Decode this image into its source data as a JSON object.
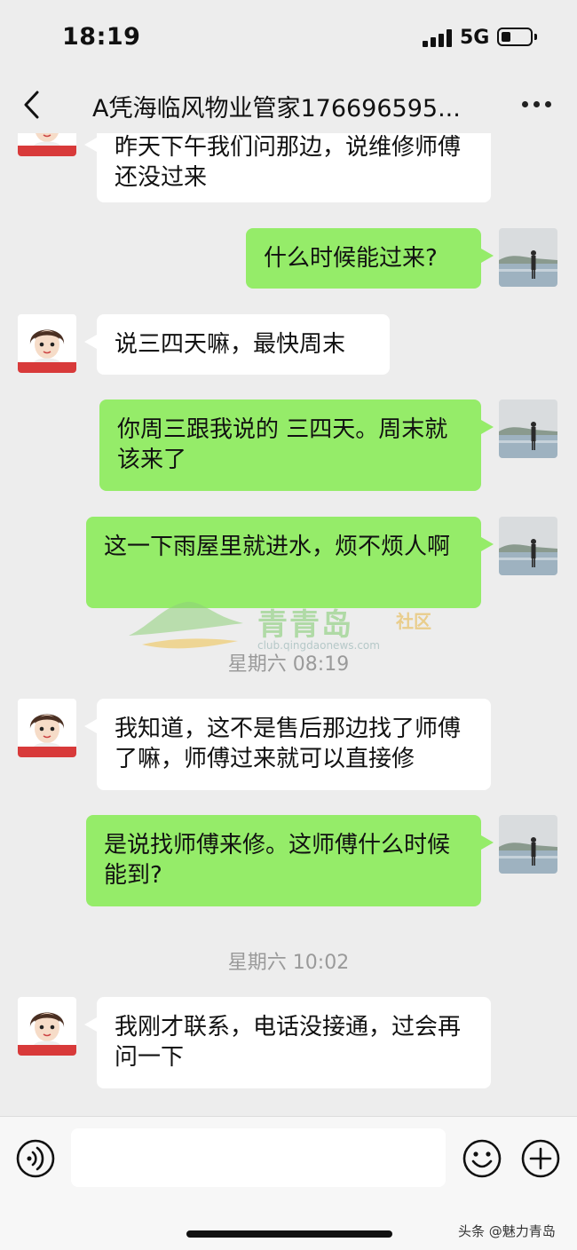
{
  "status_bar": {
    "time": "18:19",
    "network": "5G"
  },
  "header": {
    "title": "A凭海临风物业管家176696595..."
  },
  "messages": [
    {
      "side": "left",
      "text": "昨天下午我们问那边，说维修师傅还没过来"
    },
    {
      "side": "right",
      "text": "什么时候能过来?"
    },
    {
      "side": "left",
      "text": "说三四天嘛，最快周末"
    },
    {
      "side": "right",
      "text": "你周三跟我说的  三四天。周末就该来了"
    },
    {
      "side": "right",
      "text": "这一下雨屋里就进水，烦不烦人啊"
    },
    {
      "side": "left",
      "text": "我知道，这不是售后那边找了师傅了嘛，师傅过来就可以直接修"
    },
    {
      "side": "right",
      "text": "是说找师傅来修。这师傅什么时候能到?"
    },
    {
      "side": "left",
      "text": "我刚才联系，电话没接通，过会再问一下"
    }
  ],
  "timestamps": [
    "星期六 08:19",
    "星期六 10:02"
  ],
  "watermark": {
    "name": "青青岛",
    "tag": "社区",
    "url": "club.qingdaonews.com"
  },
  "input": {
    "value": ""
  },
  "source": "头条 @魅力青岛",
  "colors": {
    "background": "#ededed",
    "my_bubble": "#95ec69",
    "their_bubble": "#ffffff"
  }
}
